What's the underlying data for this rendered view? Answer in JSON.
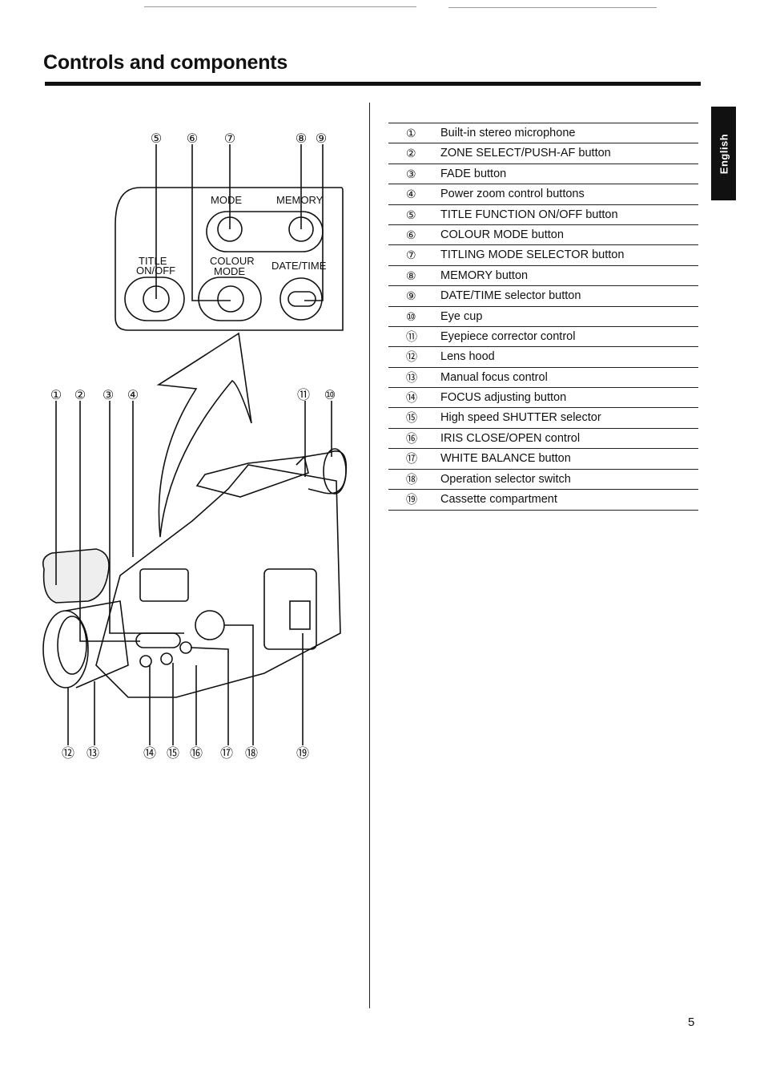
{
  "header": {
    "title": "Controls and components"
  },
  "language_tab": {
    "label": "English"
  },
  "legend": {
    "items": [
      {
        "num": "①",
        "label": "Built-in stereo microphone"
      },
      {
        "num": "②",
        "label": "ZONE SELECT/PUSH-AF button"
      },
      {
        "num": "③",
        "label": "FADE button"
      },
      {
        "num": "④",
        "label": "Power zoom control buttons"
      },
      {
        "num": "⑤",
        "label": "TITLE FUNCTION ON/OFF button"
      },
      {
        "num": "⑥",
        "label": "COLOUR MODE button"
      },
      {
        "num": "⑦",
        "label": "TITLING MODE SELECTOR button"
      },
      {
        "num": "⑧",
        "label": "MEMORY button"
      },
      {
        "num": "⑨",
        "label": "DATE/TIME selector button"
      },
      {
        "num": "⑩",
        "label": "Eye cup"
      },
      {
        "num": "⑪",
        "label": "Eyepiece corrector control"
      },
      {
        "num": "⑫",
        "label": "Lens hood"
      },
      {
        "num": "⑬",
        "label": "Manual focus control"
      },
      {
        "num": "⑭",
        "label": "FOCUS adjusting button"
      },
      {
        "num": "⑮",
        "label": "High speed SHUTTER selector"
      },
      {
        "num": "⑯",
        "label": "IRIS CLOSE/OPEN control"
      },
      {
        "num": "⑰",
        "label": "WHITE BALANCE button"
      },
      {
        "num": "⑱",
        "label": "Operation selector switch"
      },
      {
        "num": "⑲",
        "label": "Cassette compartment"
      }
    ]
  },
  "diagram": {
    "panel_labels": {
      "mode": "MODE",
      "memory": "MEMORY",
      "title_line1": "TITLE",
      "title_line2": "ON/OFF",
      "colour_line1": "COLOUR",
      "colour_line2": "MODE",
      "date_time": "DATE/TIME"
    },
    "callouts_top": [
      "⑤",
      "⑥",
      "⑦",
      "⑧",
      "⑨"
    ],
    "callouts_camera_top": [
      "①",
      "②",
      "③",
      "④",
      "⑪",
      "⑩"
    ],
    "callouts_bottom": [
      "⑫",
      "⑬",
      "⑭",
      "⑮",
      "⑯",
      "⑰",
      "⑱",
      "⑲"
    ]
  },
  "footer": {
    "page_number": "5"
  }
}
